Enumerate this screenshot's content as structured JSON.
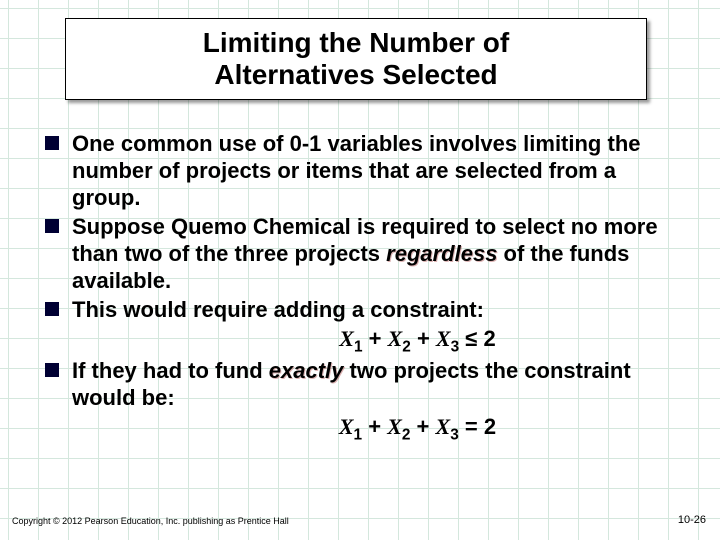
{
  "title_line1": "Limiting the Number of",
  "title_line2": "Alternatives Selected",
  "bullets": [
    {
      "pre": "One common use of 0-1 variables involves limiting the number of projects or items that are selected from a group."
    },
    {
      "pre": "Suppose Quemo Chemical is required to select no more than two of the three projects ",
      "em": "regardless",
      "post": " of the funds available."
    },
    {
      "pre": "This would require adding a constraint:"
    },
    {
      "pre": "If they had to fund ",
      "em": "exactly",
      "post": " two projects the constraint would be:"
    }
  ],
  "formula1": {
    "x1": "X",
    "s1": "1",
    "x2": "X",
    "s2": "2",
    "x3": "X",
    "s3": "3",
    "op": "≤",
    "rhs": "2"
  },
  "formula2": {
    "x1": "X",
    "s1": "1",
    "x2": "X",
    "s2": "2",
    "x3": "X",
    "s3": "3",
    "op": "=",
    "rhs": "2"
  },
  "copyright": "Copyright © 2012 Pearson Education, Inc. publishing as Prentice Hall",
  "pagenum": "10-26"
}
